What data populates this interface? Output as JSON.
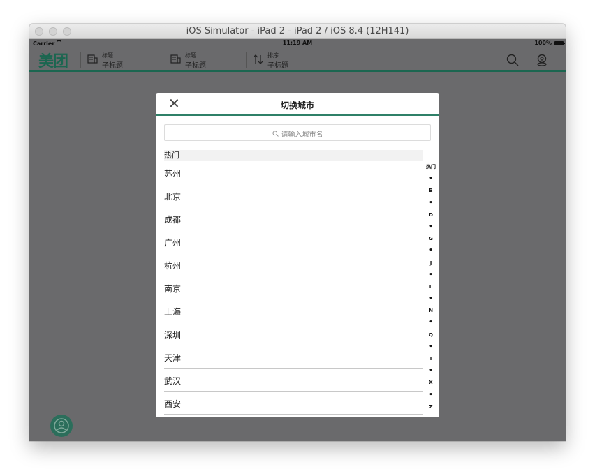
{
  "window": {
    "title": "iOS Simulator - iPad 2 - iPad 2 / iOS 8.4 (12H141)"
  },
  "status_bar": {
    "carrier": "Carrier",
    "time": "11:19 AM",
    "battery": "100%"
  },
  "navbar": {
    "logo": "美团",
    "items": [
      {
        "title": "标题",
        "subtitle": "子标题",
        "icon": "building-icon"
      },
      {
        "title": "标题",
        "subtitle": "子标题",
        "icon": "building-icon"
      },
      {
        "title": "排序",
        "subtitle": "子标题",
        "icon": "sort-arrows-icon"
      }
    ],
    "right_icons": [
      "search-icon",
      "location-pin-icon"
    ]
  },
  "modal": {
    "title": "切换城市",
    "close_icon": "close-icon",
    "search": {
      "placeholder": "请输入城市名"
    },
    "section_header": "热门",
    "cities": [
      "苏州",
      "北京",
      "成都",
      "广州",
      "杭州",
      "南京",
      "上海",
      "深圳",
      "天津",
      "武汉",
      "西安"
    ],
    "index": [
      "热门",
      "•",
      "B",
      "•",
      "D",
      "•",
      "G",
      "•",
      "J",
      "•",
      "L",
      "•",
      "N",
      "•",
      "Q",
      "•",
      "T",
      "•",
      "X",
      "•",
      "Z"
    ]
  },
  "colors": {
    "brand": "#1b6650",
    "accent": "#2f8068",
    "overlay": "#6a6a6c"
  }
}
